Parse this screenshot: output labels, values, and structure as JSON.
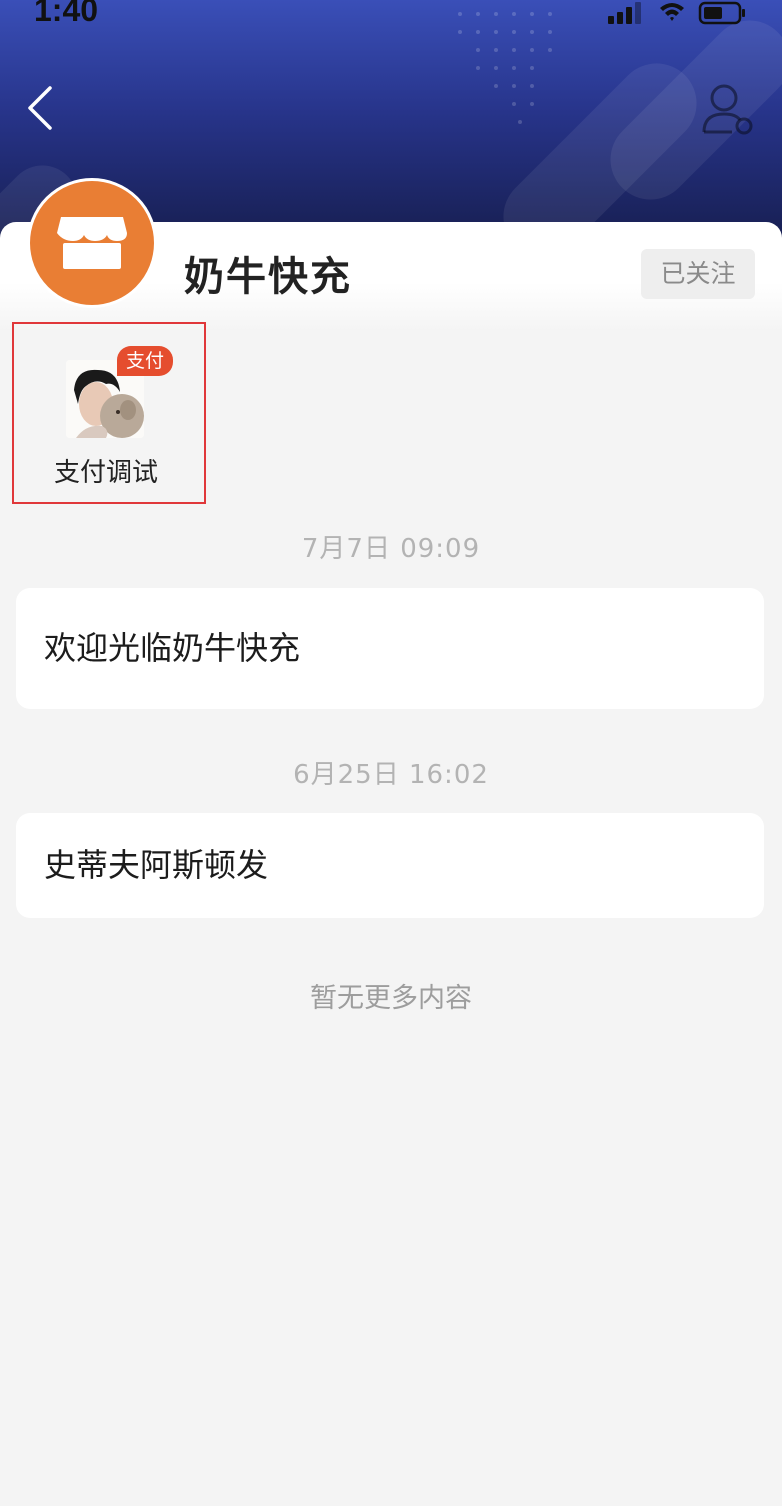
{
  "status_bar": {
    "time": "1:40"
  },
  "header": {
    "back_icon": "chevron-left-icon",
    "contact_icon": "person-settings-icon"
  },
  "shop": {
    "name": "奶牛快充",
    "follow_label": "已关注",
    "avatar_icon": "storefront-icon",
    "avatar_color": "#e97e34"
  },
  "service": {
    "tag": "支付",
    "label": "支付调试"
  },
  "messages": [
    {
      "time": "7月7日 09:09",
      "text": "欢迎光临奶牛快充"
    },
    {
      "time": "6月25日 16:02",
      "text": "史蒂夫阿斯顿发"
    }
  ],
  "footer": {
    "no_more": "暂无更多内容"
  },
  "colors": {
    "accent": "#e54d2e",
    "highlight_border": "#e0373a",
    "header_dark": "#161d4d",
    "header_light": "#3a4fb8"
  }
}
